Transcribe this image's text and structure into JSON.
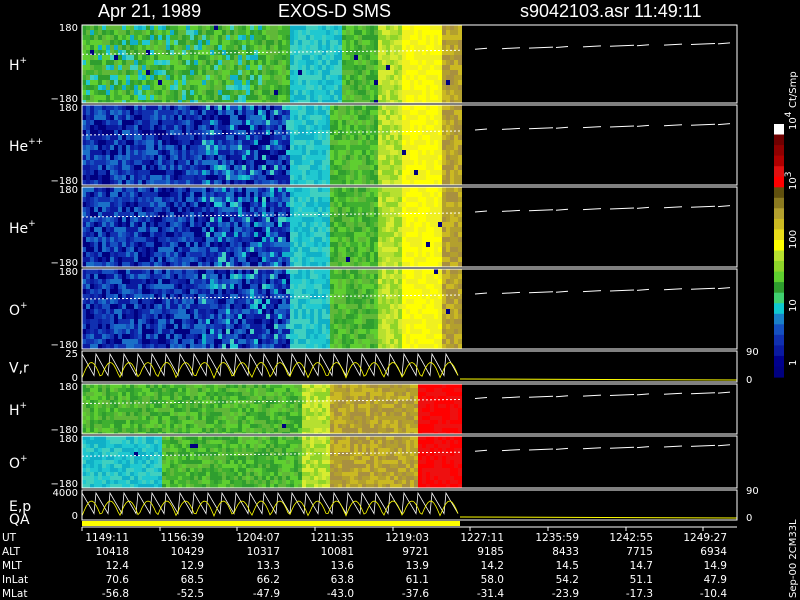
{
  "header": {
    "date": "Apr 21, 1989",
    "instrument": "EXOS-D SMS",
    "file_time": "s9042103.asr  11:49:11"
  },
  "colorbar": {
    "unit": "Ct/Smp",
    "tick_labels": [
      "1",
      "10",
      "100",
      "10",
      "10"
    ],
    "tick_exponents": [
      "",
      "",
      "",
      "3",
      "4"
    ],
    "colors": [
      "#000080",
      "#00008c",
      "#0a1aa0",
      "#1030b0",
      "#1550c0",
      "#1a80c8",
      "#10c8d0",
      "#40d070",
      "#2f9e2f",
      "#5fcf30",
      "#8ed42a",
      "#b6e030",
      "#ffff00",
      "#e8dc1a",
      "#cbb922",
      "#b3a02e",
      "#8b7a20",
      "#60500e",
      "#ff0000",
      "#e01010",
      "#b00000",
      "#900000",
      "#700000",
      "#ffffff"
    ]
  },
  "panels": [
    {
      "label": "H",
      "sup": "+",
      "ticks": [
        "180",
        "−180"
      ]
    },
    {
      "label": "He",
      "sup": "++",
      "ticks": [
        "180",
        "−180"
      ]
    },
    {
      "label": "He",
      "sup": "+",
      "ticks": [
        "180",
        "−180"
      ]
    },
    {
      "label": "O",
      "sup": "+",
      "ticks": [
        "180",
        "−180"
      ]
    },
    {
      "label": "V,r",
      "sup": "",
      "ticks": [
        "25",
        "0"
      ],
      "right_ticks": [
        "90",
        "0"
      ]
    },
    {
      "label": "H",
      "sup": "+",
      "ticks": [
        "180",
        "−180"
      ]
    },
    {
      "label": "O",
      "sup": "+",
      "ticks": [
        "180",
        "−180"
      ]
    },
    {
      "label": "E,p",
      "sup": "",
      "ticks": [
        "4000",
        "0"
      ],
      "right_ticks": [
        "90",
        "0"
      ]
    }
  ],
  "qa_label": "QA",
  "footer": {
    "rows": [
      {
        "name": "UT",
        "values": [
          "1149:11",
          "1156:39",
          "1204:07",
          "1211:35",
          "1219:03",
          "1227:11",
          "1235:59",
          "1242:55",
          "1249:27"
        ]
      },
      {
        "name": "ALT",
        "values": [
          "10418",
          "10429",
          "10317",
          "10081",
          "9721",
          "9185",
          "8433",
          "7715",
          "6934"
        ]
      },
      {
        "name": "MLT",
        "values": [
          "12.4",
          "12.9",
          "13.3",
          "13.6",
          "13.9",
          "14.2",
          "14.5",
          "14.7",
          "14.9"
        ]
      },
      {
        "name": "InLat",
        "values": [
          "70.6",
          "68.5",
          "66.2",
          "63.8",
          "61.1",
          "58.0",
          "54.2",
          "51.1",
          "47.9"
        ]
      },
      {
        "name": "MLat",
        "values": [
          "-56.8",
          "-52.5",
          "-47.9",
          "-43.0",
          "-37.6",
          "-31.4",
          "-23.9",
          "-17.3",
          "-10.4"
        ]
      }
    ],
    "side_note": "Sep-00  2CM33L"
  },
  "chart_data": {
    "type": "heatmap",
    "title": "Apr 21, 1989   EXOS-D SMS",
    "file": "s9042103.asr",
    "time": "11:49:11",
    "x_ticks_ut": [
      "1149:11",
      "1156:39",
      "1204:07",
      "1211:35",
      "1219:03",
      "1227:11",
      "1235:59",
      "1242:55",
      "1249:27"
    ],
    "data_coverage_ut": [
      "1149:11",
      "1223:00"
    ],
    "color_scale": {
      "unit": "Ct/Smp",
      "scale": "log",
      "range": [
        1,
        10000
      ]
    },
    "series": [
      {
        "name": "H+",
        "ylim": [
          -180,
          180
        ]
      },
      {
        "name": "He++",
        "ylim": [
          -180,
          180
        ]
      },
      {
        "name": "He+",
        "ylim": [
          -180,
          180
        ]
      },
      {
        "name": "O+",
        "ylim": [
          -180,
          180
        ]
      },
      {
        "name": "V,r",
        "ylim": [
          0,
          25
        ],
        "right_ylim": [
          0,
          90
        ]
      },
      {
        "name": "H+",
        "ylim": [
          -180,
          180
        ]
      },
      {
        "name": "O+",
        "ylim": [
          -180,
          180
        ]
      },
      {
        "name": "E,p",
        "ylim": [
          0,
          4000
        ],
        "right_ylim": [
          0,
          90
        ]
      },
      {
        "name": "QA"
      }
    ]
  }
}
